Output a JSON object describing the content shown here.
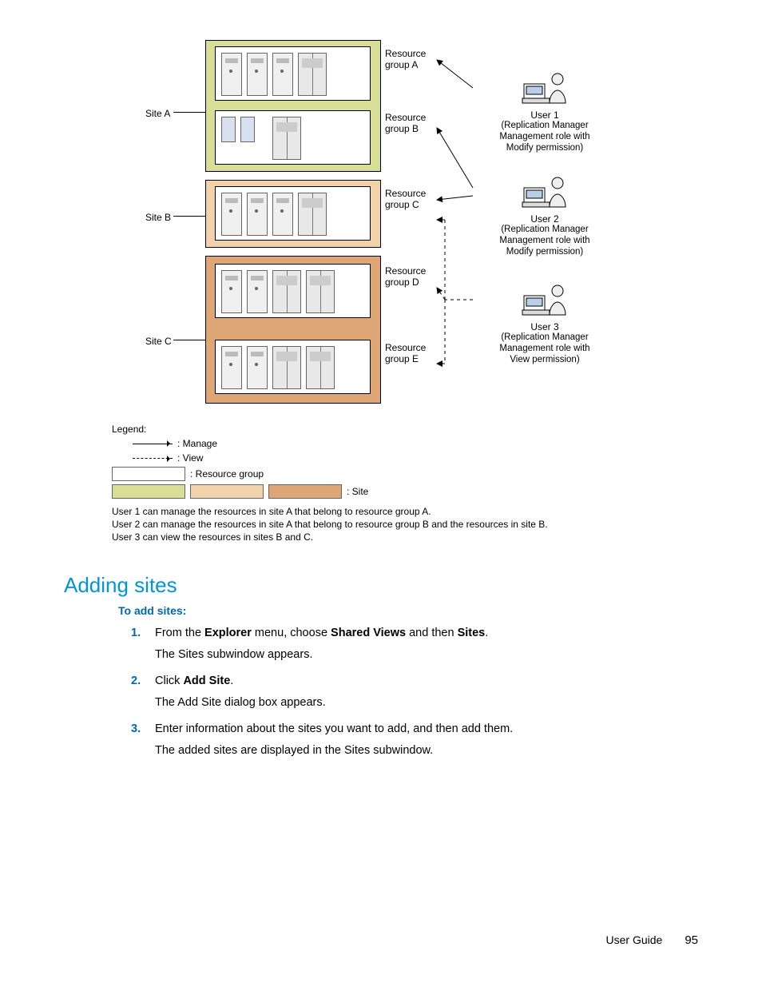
{
  "diagram": {
    "siteA": "Site A",
    "siteB": "Site B",
    "siteC": "Site C",
    "resA": "Resource\ngroup A",
    "resB": "Resource\ngroup B",
    "resC": "Resource\ngroup C",
    "resD": "Resource\ngroup D",
    "resE": "Resource\ngroup E",
    "user1": {
      "name": "User 1",
      "role": "(Replication Manager\nManagement role with\nModify permission)"
    },
    "user2": {
      "name": "User 2",
      "role": "(Replication Manager\nManagement role with\nModify permission)"
    },
    "user3": {
      "name": "User 3",
      "role": "(Replication Manager\nManagement role with\nView permission)"
    }
  },
  "legend": {
    "title": "Legend:",
    "manage": ": Manage",
    "view": ": View",
    "resgroup": ": Resource group",
    "site": ": Site"
  },
  "notes": {
    "n1": "User 1 can manage the resources in site A that belong to resource group A.",
    "n2": "User 2 can manage the resources in site A that belong to resource group B and the resources in site B.",
    "n3": "User 3 can view the resources in sites B and C."
  },
  "section_title": "Adding sites",
  "subhead": "To add sites:",
  "steps": {
    "s1_num": "1.",
    "s1a_pre": "From the ",
    "s1a_b1": "Explorer",
    "s1a_mid1": " menu, choose ",
    "s1a_b2": "Shared Views",
    "s1a_mid2": " and then ",
    "s1a_b3": "Sites",
    "s1a_post": ".",
    "s1b": "The Sites subwindow appears.",
    "s2_num": "2.",
    "s2a_pre": "Click ",
    "s2a_b1": "Add Site",
    "s2a_post": ".",
    "s2b": "The Add Site dialog box appears.",
    "s3_num": "3.",
    "s3a": "Enter information about the sites you want to add, and then add them.",
    "s3b": "The added sites are displayed in the Sites subwindow."
  },
  "footer": {
    "label": "User Guide",
    "page": "95"
  }
}
